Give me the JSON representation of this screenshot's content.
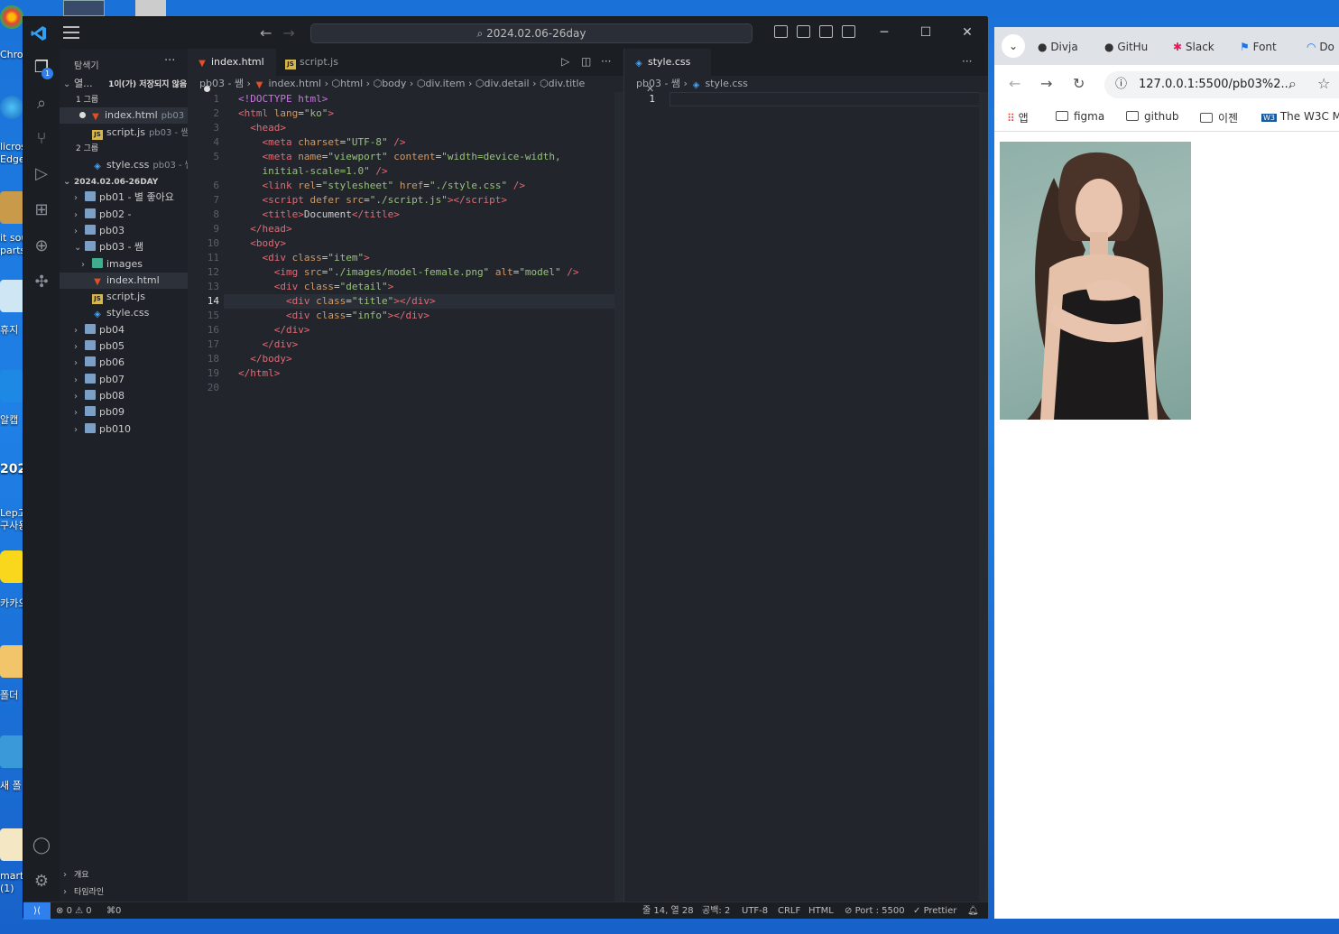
{
  "desktop": {
    "labels": [
      "Chron",
      "licros",
      "Edge",
      "it sou",
      "parts",
      "휴지",
      "알캡",
      "202",
      "Lep고",
      "구사용",
      "카카오",
      "폴더",
      "새 폴",
      "martA",
      "(1)"
    ]
  },
  "vscode": {
    "title": "2024.02.06-26day",
    "explorer_title": "탐색기",
    "open_editors": {
      "header": "열...",
      "unsaved": "1이(가) 저장되지 않음",
      "group1": "1 그룹",
      "group2": "2 그룹",
      "items": [
        {
          "name": "index.html",
          "hint": "pb03 ..."
        },
        {
          "name": "script.js",
          "hint": "pb03 - 쌤"
        },
        {
          "name": "style.css",
          "hint": "pb03 - 쌤"
        }
      ]
    },
    "workspace": {
      "name": "2024.02.06-26DAY",
      "folders_top": [
        "pb01 - 별 좋아요",
        "pb02 -",
        "pb03",
        "pb03 - 쌤"
      ],
      "pb03_children": [
        "images",
        "index.html",
        "script.js",
        "style.css"
      ],
      "folders_bottom": [
        "pb04",
        "pb05",
        "pb06",
        "pb07",
        "pb08",
        "pb09",
        "pb010"
      ]
    },
    "outline": "개요",
    "timeline": "타임라인",
    "left_tabs": [
      "index.html",
      "script.js"
    ],
    "right_tab": "style.css",
    "left_breadcrumb": [
      "pb03 - 쌤",
      "index.html",
      "html",
      "body",
      "div.item",
      "div.detail",
      "div.title"
    ],
    "right_breadcrumb": [
      "pb03 - 쌤",
      "style.css"
    ],
    "code_lines": [
      "1",
      "2",
      "3",
      "4",
      "5",
      "",
      "6",
      "7",
      "8",
      "9",
      "10",
      "11",
      "12",
      "13",
      "14",
      "15",
      "16",
      "17",
      "18",
      "19",
      "20"
    ],
    "right_line": "1",
    "status": {
      "errors": "0",
      "warnings": "0",
      "ports": "0",
      "position": "줄 14, 열 28",
      "spaces": "공백: 2",
      "encoding": "UTF-8",
      "eol": "CRLF",
      "language": "HTML",
      "port": "Port : 5500",
      "formatter": "Prettier"
    }
  },
  "chrome": {
    "tabs": [
      "Divja",
      "GitHu",
      "Slack",
      "Font",
      "Do"
    ],
    "url": "127.0.0.1:5500/pb03%2...",
    "bookmarks": [
      "앱",
      "figma",
      "github",
      "이젠",
      "The W3C M"
    ]
  },
  "colors": {
    "accent": "#2f80ed",
    "editor_bg": "#22252c",
    "tag": "#e06c75",
    "attr": "#d19a66",
    "string": "#98c379"
  }
}
